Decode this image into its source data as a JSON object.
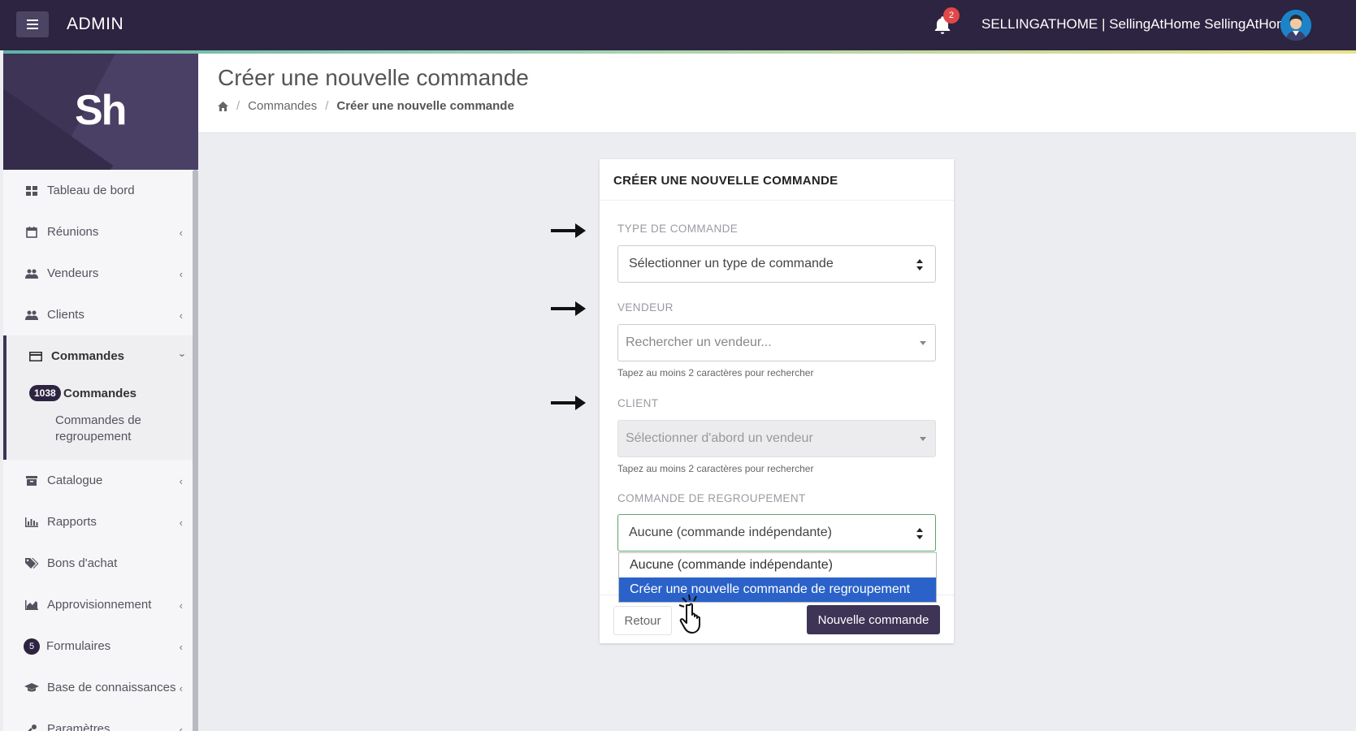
{
  "topbar": {
    "brand": "ADMIN",
    "notification_count": "2",
    "user": "SELLINGATHOME | SellingAtHome SellingAtHome"
  },
  "sidebar": {
    "logo": "Sh",
    "items": [
      {
        "label": "Tableau de bord",
        "icon": "dashboard-icon"
      },
      {
        "label": "Réunions",
        "icon": "calendar-icon"
      },
      {
        "label": "Vendeurs",
        "icon": "users-icon"
      },
      {
        "label": "Clients",
        "icon": "users-icon"
      }
    ],
    "active_group": {
      "label": "Commandes",
      "icon": "credit-card-icon",
      "subitems": [
        {
          "label": "Commandes",
          "badge": "1038"
        },
        {
          "label": "Commandes de regroupement"
        }
      ]
    },
    "items_after": [
      {
        "label": "Catalogue",
        "icon": "archive-icon"
      },
      {
        "label": "Rapports",
        "icon": "bar-chart-icon"
      },
      {
        "label": "Bons d'achat",
        "icon": "tags-icon"
      },
      {
        "label": "Approvisionnement",
        "icon": "area-chart-icon"
      },
      {
        "label": "Formulaires",
        "badge": "5"
      },
      {
        "label": "Base de connaissances",
        "icon": "graduation-cap-icon"
      },
      {
        "label": "Paramètres",
        "icon": "wrench-icon"
      }
    ]
  },
  "header": {
    "title": "Créer une nouvelle commande",
    "breadcrumb": [
      "Commandes",
      "Créer une nouvelle commande"
    ]
  },
  "form": {
    "title": "CRÉER UNE NOUVELLE COMMANDE",
    "type_label": "TYPE DE COMMANDE",
    "type_value": "Sélectionner un type de commande",
    "vendeur_label": "VENDEUR",
    "vendeur_placeholder": "Rechercher un vendeur...",
    "vendeur_help": "Tapez au moins 2 caractères pour rechercher",
    "client_label": "CLIENT",
    "client_placeholder": "Sélectionner d'abord un vendeur",
    "client_help": "Tapez au moins 2 caractères pour rechercher",
    "regroupement_label": "COMMANDE DE REGROUPEMENT",
    "regroupement_value": "Aucune (commande indépendante)",
    "regroupement_options": [
      "Aucune (commande indépendante)",
      "Créer une nouvelle commande de regroupement"
    ],
    "back_label": "Retour",
    "submit_label": "Nouvelle commande"
  },
  "colors": {
    "topbar": "#2c2440",
    "primary": "#3e3456",
    "selected_option": "#2a62c9",
    "badge": "#e04848"
  }
}
